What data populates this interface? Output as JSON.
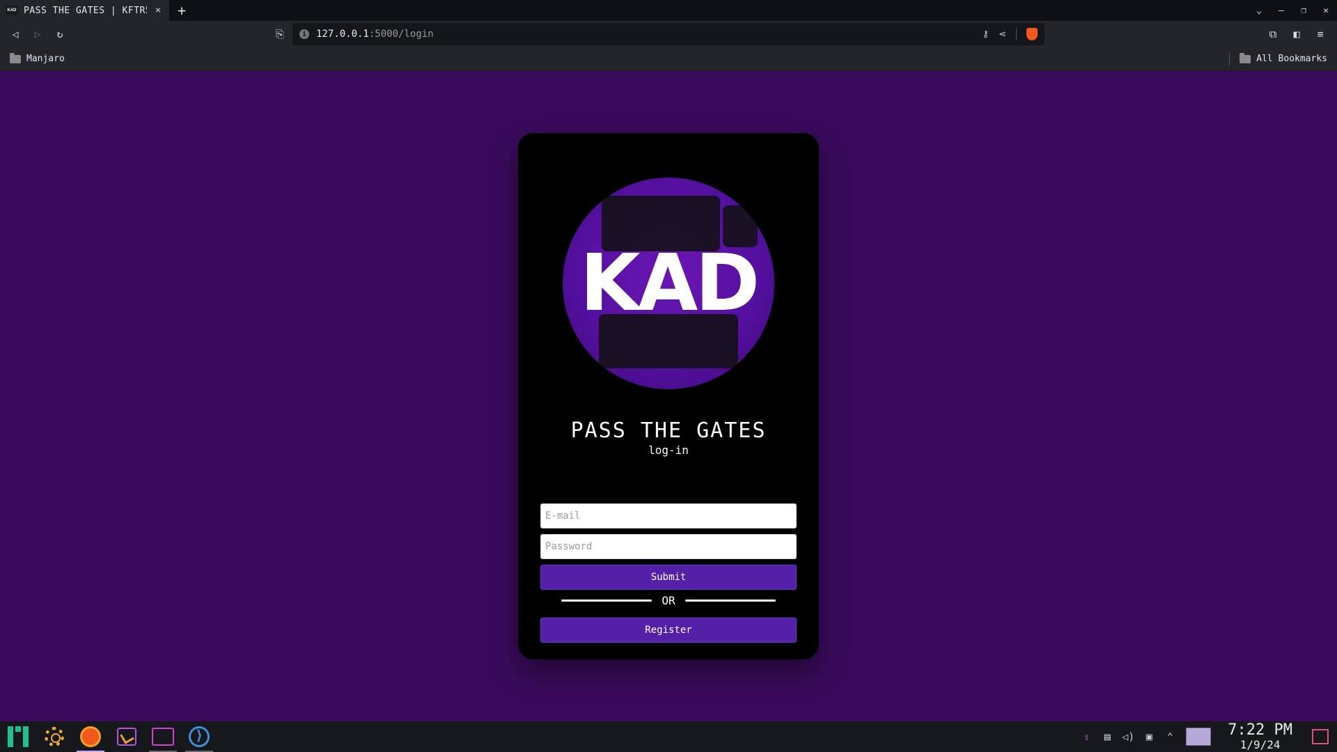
{
  "browser": {
    "tab": {
      "favicon_text": "KAD",
      "title": "PASS THE GATES | KFTR5",
      "close": "×",
      "new_tab": "+"
    },
    "window_controls": {
      "dropdown": "⌄",
      "minimize": "–",
      "restore": "❐",
      "close": "✕"
    },
    "toolbar": {
      "back": "◁",
      "forward": "▷",
      "reload": "↻",
      "bookmark": "⎘",
      "url_host": "127.0.0.1",
      "url_path": ":5000/login",
      "key_icon": "⚷",
      "share_icon": "⋖",
      "extensions": "⧉",
      "sidebar": "◧",
      "menu": "≡"
    },
    "bookmarks": {
      "left_item": "Manjaro",
      "right_item": "All Bookmarks"
    }
  },
  "login": {
    "logo_text": "KAD",
    "title": "PASS THE GATES",
    "subtitle": "log-in",
    "email_placeholder": "E-mail",
    "password_placeholder": "Password",
    "submit_label": "Submit",
    "or_label": "OR",
    "register_label": "Register"
  },
  "taskbar": {
    "apps": [
      "manjaro-menu",
      "system-settings",
      "brave-browser",
      "drawing-app",
      "file-manager",
      "vscode"
    ],
    "tray_icons": {
      "update": "⇪",
      "clipboard": "▤",
      "volume": "◁)",
      "network": "▣",
      "expand": "⌃"
    },
    "clock": {
      "time": "7:22 PM",
      "date": "1/9/24"
    }
  },
  "colors": {
    "page_bg": "#3a0b5c",
    "card_bg": "#000000",
    "button_bg": "#5520a8",
    "logo_circle": "#5510a0"
  }
}
